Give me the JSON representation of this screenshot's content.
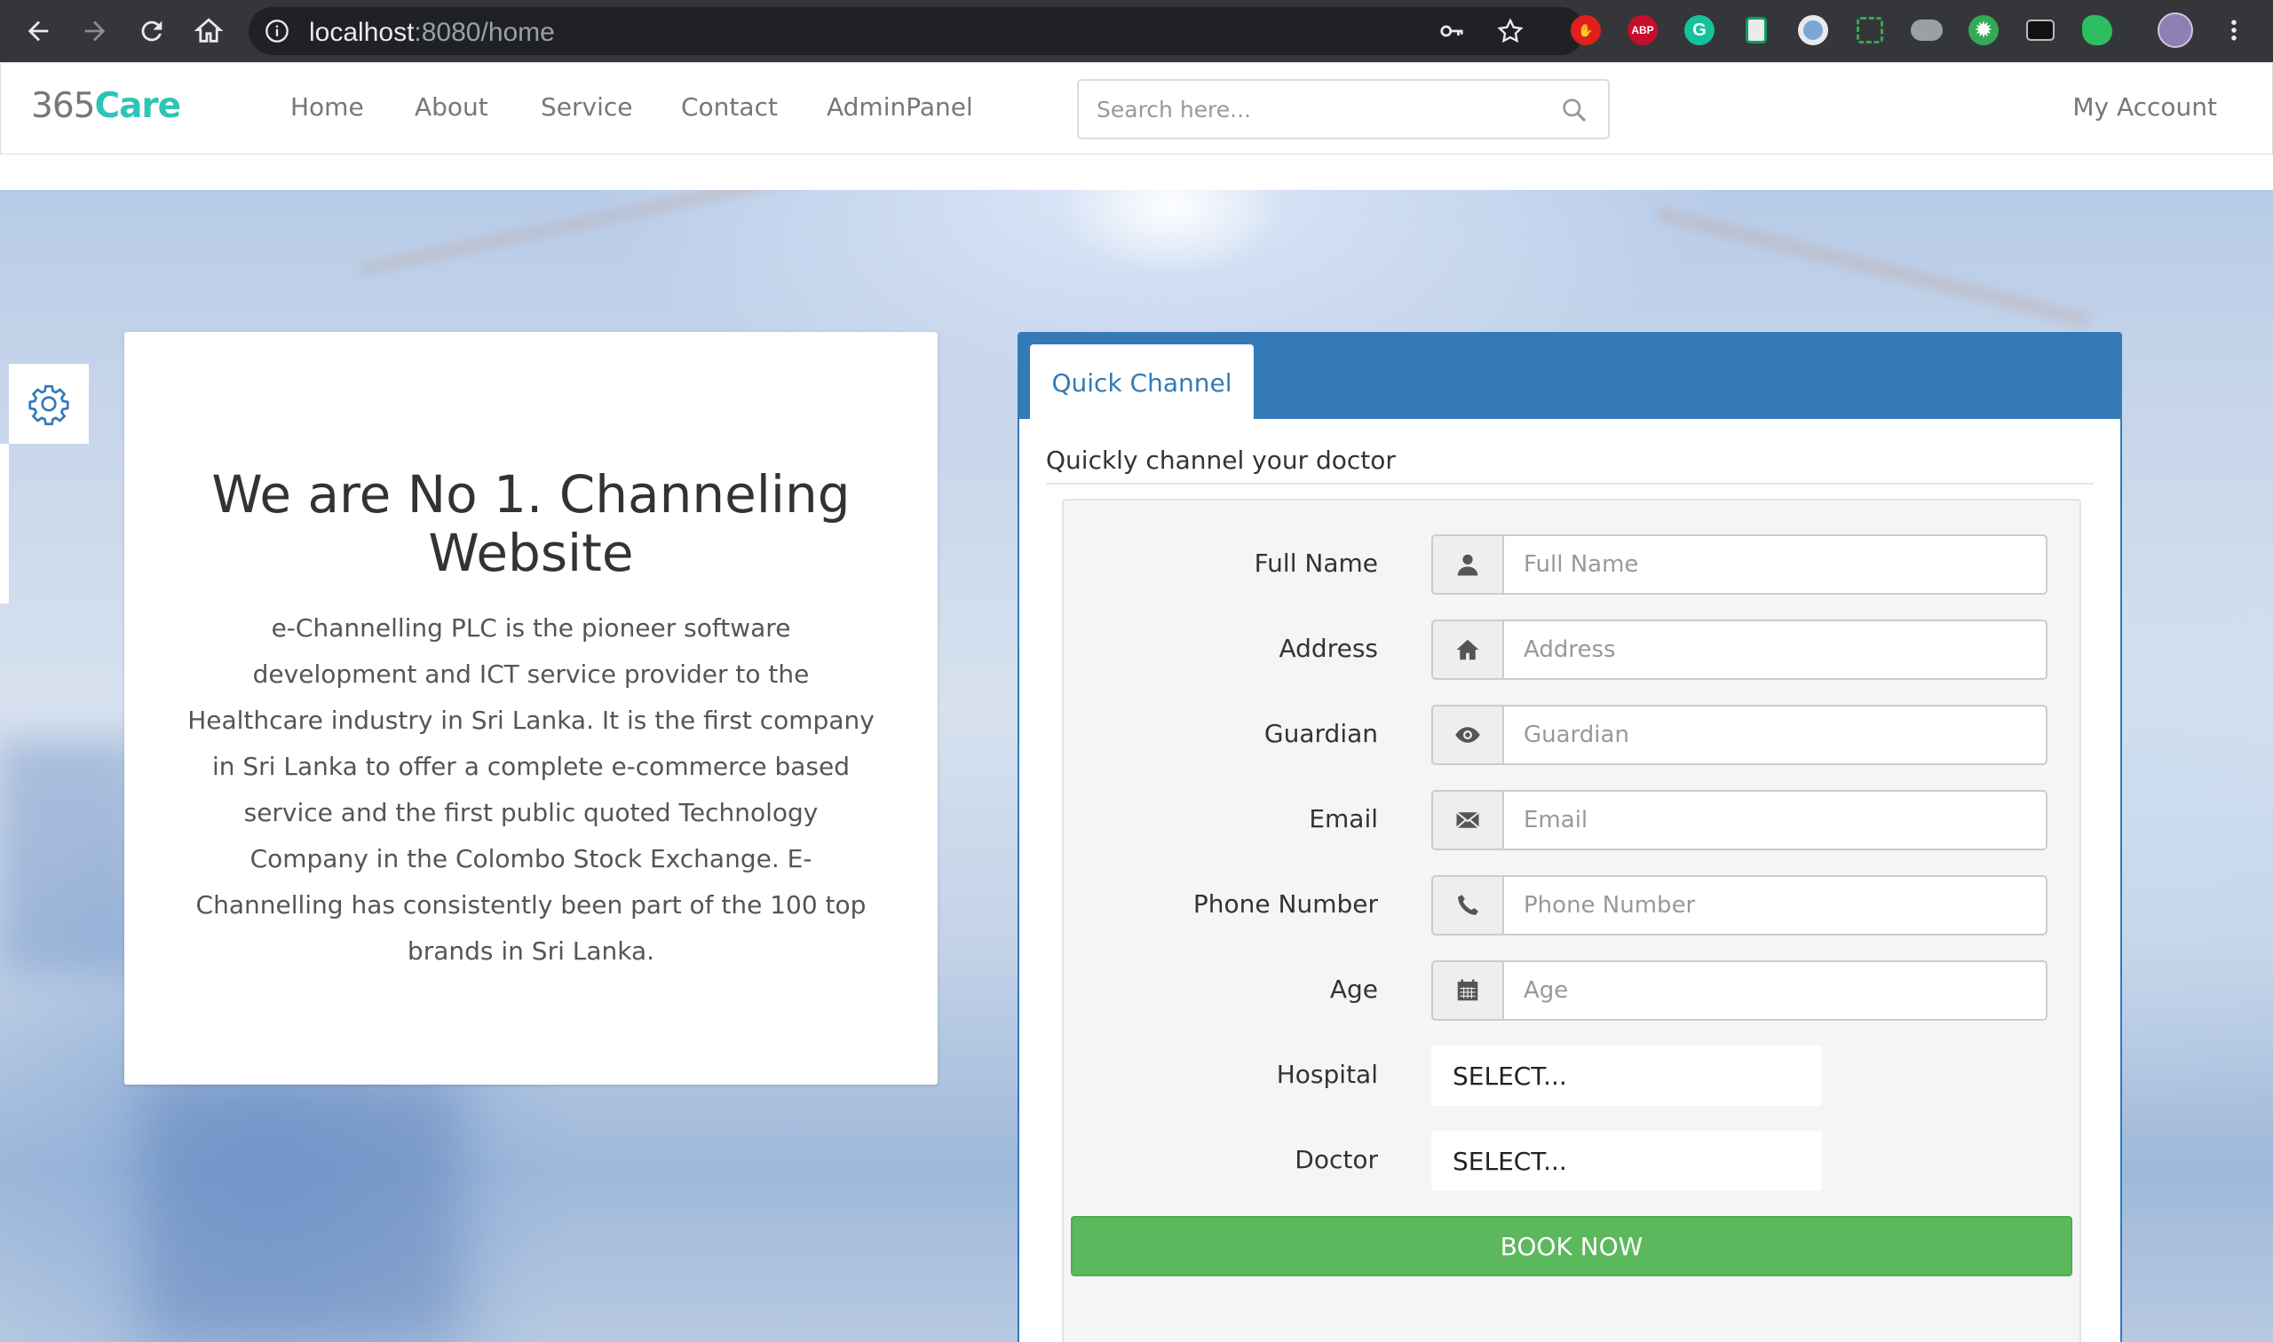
{
  "browser": {
    "url_host": "localhost",
    "url_path": ":8080/home",
    "extensions": [
      "adblock-icon",
      "abp-icon",
      "grammarly-icon",
      "docs-icon",
      "circle-extension-icon",
      "screenshot-icon",
      "cloud-extension-icon",
      "gear-extension-icon",
      "terminal-icon",
      "evernote-icon",
      "profile-avatar"
    ],
    "extension_labels": {
      "abp": "ABP",
      "grammarly": "G"
    }
  },
  "site": {
    "brand_prefix": "365",
    "brand_accent": "Care",
    "nav": [
      "Home",
      "About",
      "Service",
      "Contact",
      "AdminPanel"
    ],
    "search_placeholder": "Search here...",
    "account": "My Account"
  },
  "hero": {
    "title": "We are No 1. Channeling Website",
    "description": "e-Channelling PLC is the pioneer software development and ICT service provider to the Healthcare industry in Sri Lanka. It is the first company in Sri Lanka to offer a complete e-commerce based service and the first public quoted Technology Company in the Colombo Stock Exchange. E-Channelling has consistently been part of the 100 top brands in Sri Lanka."
  },
  "quick_channel": {
    "tab": "Quick Channel",
    "subtitle": "Quickly channel your doctor",
    "fields": [
      {
        "label": "Full Name",
        "placeholder": "Full Name",
        "icon": "user-icon"
      },
      {
        "label": "Address",
        "placeholder": "Address",
        "icon": "home-icon"
      },
      {
        "label": "Guardian",
        "placeholder": "Guardian",
        "icon": "eye-icon"
      },
      {
        "label": "Email",
        "placeholder": "Email",
        "icon": "envelope-icon"
      },
      {
        "label": "Phone Number",
        "placeholder": "Phone Number",
        "icon": "phone-icon"
      },
      {
        "label": "Age",
        "placeholder": "Age",
        "icon": "calendar-icon"
      }
    ],
    "hospital_label": "Hospital",
    "hospital_value": "SELECT...",
    "doctor_label": "Doctor",
    "doctor_value": "SELECT...",
    "book_button": "BOOK NOW"
  },
  "colors": {
    "brand_accent": "#2ec4b6",
    "primary": "#337ab7",
    "success": "#5cb85c",
    "chrome_dark": "#35363a"
  }
}
